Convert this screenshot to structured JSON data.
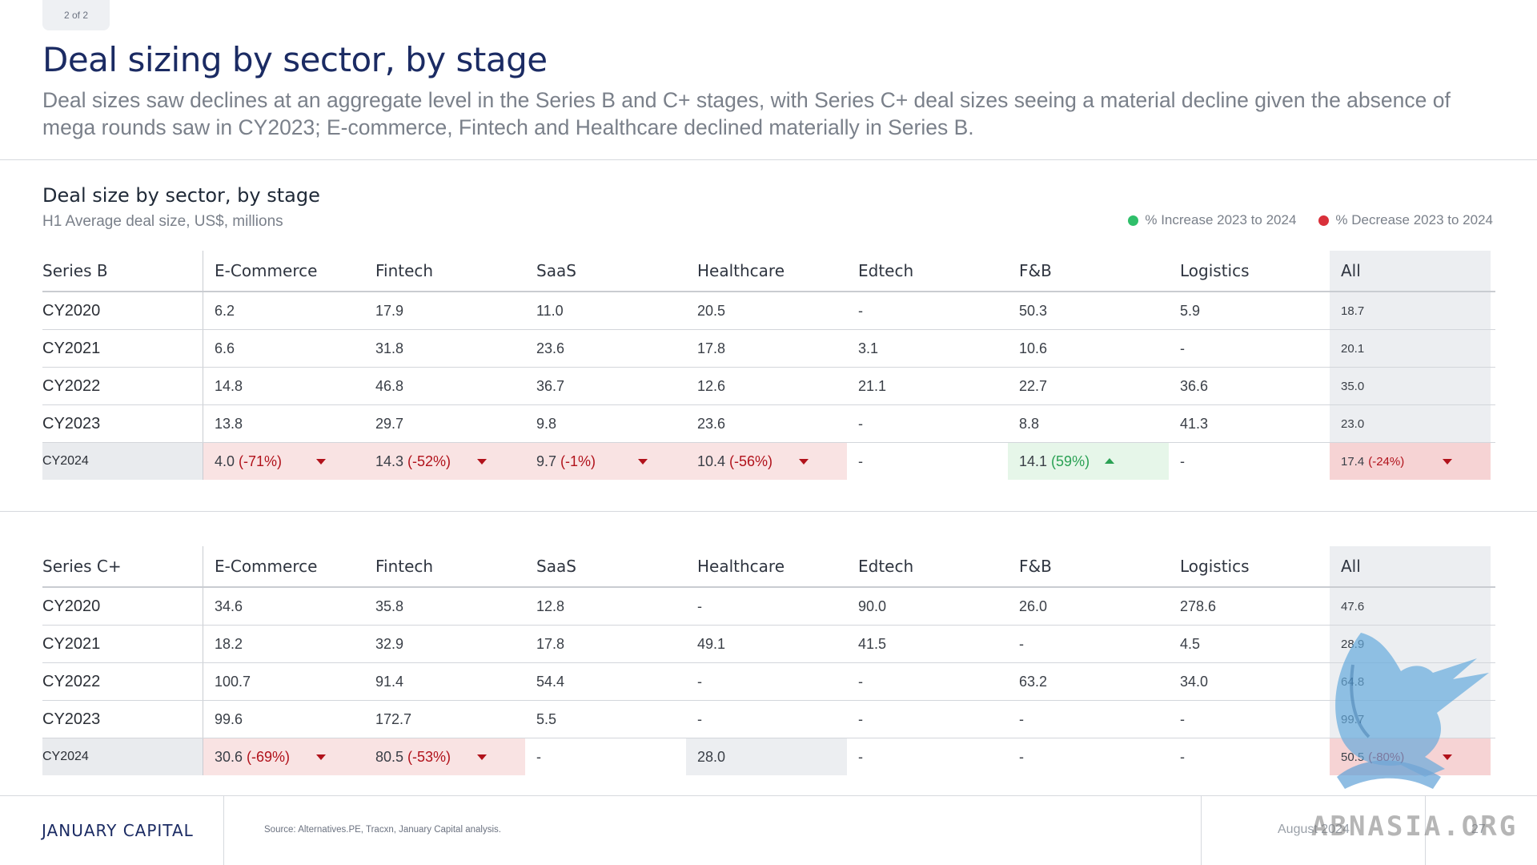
{
  "page_badge": "2 of 2",
  "title": "Deal sizing by sector, by stage",
  "subtitle": "Deal sizes saw declines at an aggregate level in the Series B and C+ stages, with Series C+ deal sizes seeing a material decline given the absence of mega rounds saw in CY2023; E-commerce, Fintech and Healthcare declined materially in Series B.",
  "section": {
    "title": "Deal size by sector, by stage",
    "subtitle": "H1 Average deal size, US$, millions"
  },
  "legend": {
    "increase": "% Increase 2023 to 2024",
    "decrease": "% Decrease 2023 to 2024",
    "increase_color": "#2fbf6a",
    "decrease_color": "#d9303a"
  },
  "series_b": {
    "stage": "Series B",
    "columns": [
      "E-Commerce",
      "Fintech",
      "SaaS",
      "Healthcare",
      "Edtech",
      "F&B",
      "Logistics",
      "All"
    ],
    "rows": [
      {
        "year": "CY2020",
        "values": [
          "6.2",
          "17.9",
          "11.0",
          "20.5",
          "-",
          "50.3",
          "5.9",
          "18.7"
        ]
      },
      {
        "year": "CY2021",
        "values": [
          "6.6",
          "31.8",
          "23.6",
          "17.8",
          "3.1",
          "10.6",
          "-",
          "20.1"
        ]
      },
      {
        "year": "CY2022",
        "values": [
          "14.8",
          "46.8",
          "36.7",
          "12.6",
          "21.1",
          "22.7",
          "36.6",
          "35.0"
        ]
      },
      {
        "year": "CY2023",
        "values": [
          "13.8",
          "29.7",
          "9.8",
          "23.6",
          "-",
          "8.8",
          "41.3",
          "23.0"
        ]
      }
    ],
    "cy2024": {
      "year": "CY2024",
      "cells": [
        {
          "value": "4.0",
          "change": "(-71%)",
          "trend": "down"
        },
        {
          "value": "14.3",
          "change": "(-52%)",
          "trend": "down"
        },
        {
          "value": "9.7",
          "change": "(-1%)",
          "trend": "down"
        },
        {
          "value": "10.4",
          "change": "(-56%)",
          "trend": "down"
        },
        {
          "value": "-",
          "change": "",
          "trend": "none"
        },
        {
          "value": "14.1",
          "change": "(59%)",
          "trend": "up"
        },
        {
          "value": "-",
          "change": "",
          "trend": "none"
        },
        {
          "value": "17.4",
          "change": "(-24%)",
          "trend": "down"
        }
      ]
    }
  },
  "series_c": {
    "stage": "Series C+",
    "columns": [
      "E-Commerce",
      "Fintech",
      "SaaS",
      "Healthcare",
      "Edtech",
      "F&B",
      "Logistics",
      "All"
    ],
    "rows": [
      {
        "year": "CY2020",
        "values": [
          "34.6",
          "35.8",
          "12.8",
          "-",
          "90.0",
          "26.0",
          "278.6",
          "47.6"
        ]
      },
      {
        "year": "CY2021",
        "values": [
          "18.2",
          "32.9",
          "17.8",
          "49.1",
          "41.5",
          "-",
          "4.5",
          "28.9"
        ]
      },
      {
        "year": "CY2022",
        "values": [
          "100.7",
          "91.4",
          "54.4",
          "-",
          "-",
          "63.2",
          "34.0",
          "64.8"
        ]
      },
      {
        "year": "CY2023",
        "values": [
          "99.6",
          "172.7",
          "5.5",
          "-",
          "-",
          "-",
          "-",
          "99.7"
        ]
      }
    ],
    "cy2024": {
      "year": "CY2024",
      "cells": [
        {
          "value": "30.6",
          "change": "(-69%)",
          "trend": "down"
        },
        {
          "value": "80.5",
          "change": "(-53%)",
          "trend": "down"
        },
        {
          "value": "-",
          "change": "",
          "trend": "none"
        },
        {
          "value": "28.0",
          "change": "",
          "trend": "flat"
        },
        {
          "value": "-",
          "change": "",
          "trend": "none"
        },
        {
          "value": "-",
          "change": "",
          "trend": "none"
        },
        {
          "value": "-",
          "change": "",
          "trend": "none"
        },
        {
          "value": "50.5",
          "change": "(-80%)",
          "trend": "down"
        }
      ]
    }
  },
  "footer": {
    "logo": "JANUARY CAPITAL",
    "source": "Source: Alternatives.PE, Tracxn, January Capital analysis.",
    "date": "August 2024",
    "page": "27"
  },
  "watermark": {
    "text": "ABNASIA.ORG",
    "icon": "griffin-logo-icon"
  }
}
